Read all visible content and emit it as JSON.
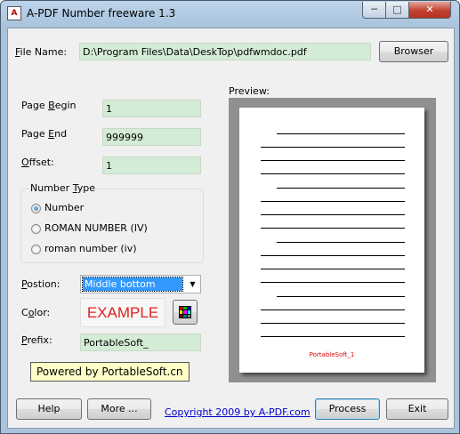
{
  "window": {
    "title": "A-PDF Number freeware 1.3",
    "icon_text": "A",
    "min_glyph": "─",
    "max_glyph": "□",
    "close_glyph": "✕"
  },
  "file": {
    "label_underlined": "F",
    "label_rest": "ile Name:",
    "value": "D:\\Program Files\\Data\\DeskTop\\pdfwmdoc.pdf",
    "browse_button": "Browser"
  },
  "page_begin": {
    "label_start": "Page ",
    "label_underlined": "B",
    "label_end": "egin",
    "value": "1"
  },
  "page_end": {
    "label_start": "Page ",
    "label_underlined": "E",
    "label_end": "nd",
    "value": "999999"
  },
  "offset": {
    "label_underlined": "O",
    "label_rest": "ffset:",
    "value": "1"
  },
  "number_type": {
    "title_start": "Number ",
    "title_underlined": "T",
    "title_end": "ype",
    "options": [
      "Number",
      "ROMAN NUMBER (IV)",
      "roman number (iv)"
    ],
    "selected_index": 0
  },
  "position": {
    "label_underlined": "P",
    "label_rest": "ostion:",
    "value": "Middle bottom",
    "arrow": "▼"
  },
  "color": {
    "label_start": "C",
    "label_underlined": "o",
    "label_end": "lor:",
    "sample_text": "EXAMPLE",
    "sample_color": "#e02020"
  },
  "prefix": {
    "label_underlined": "P",
    "label_rest": "refix:",
    "value": "PortableSoft_"
  },
  "powered_by": "Powered by PortableSoft.cn",
  "preview": {
    "label": "Preview:",
    "stamp_text": "PortableSoft_1"
  },
  "footer": {
    "help_button": "Help",
    "more_button": "More ...",
    "copyright_link": "Copyright 2009 by A-PDF.com",
    "process_button": "Process",
    "exit_button": "Exit"
  }
}
